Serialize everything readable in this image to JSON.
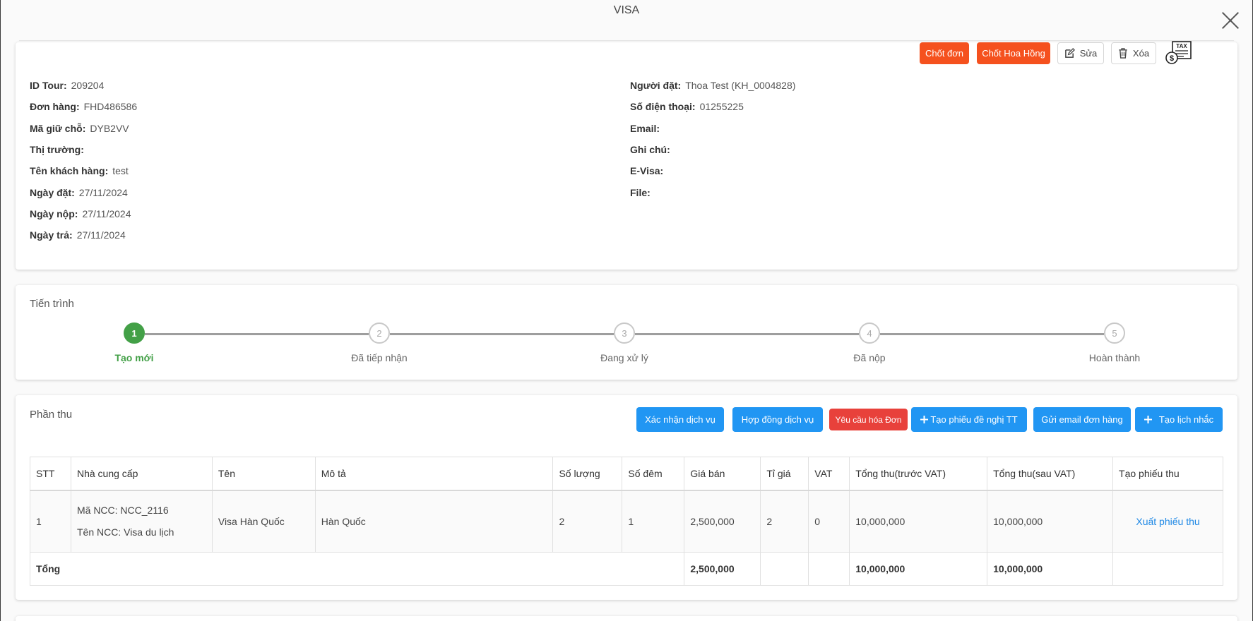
{
  "modal": {
    "title": "VISA"
  },
  "actions": {
    "chot_don": "Chốt đơn",
    "chot_hoa_hong": "Chốt Hoa Hồng",
    "sua": "Sửa",
    "xoa": "Xóa",
    "tax_icon": "tax-invoice-icon",
    "tax_text": "TAX"
  },
  "info": {
    "left": [
      {
        "label": "ID Tour",
        "value": "209204"
      },
      {
        "label": "Đơn hàng",
        "value": "FHD486586"
      },
      {
        "label": "Mã giữ chỗ",
        "value": "DYB2VV"
      },
      {
        "label": "Thị trường",
        "value": ""
      },
      {
        "label": "Tên khách hàng",
        "value": "test"
      },
      {
        "label": "Ngày đặt",
        "value": "27/11/2024"
      },
      {
        "label": "Ngày nộp",
        "value": "27/11/2024"
      },
      {
        "label": "Ngày trả",
        "value": "27/11/2024"
      }
    ],
    "right": [
      {
        "label": "Người đặt",
        "value": "Thoa Test (KH_0004828)"
      },
      {
        "label": "Số điện thoại",
        "value": "01255225"
      },
      {
        "label": "Email",
        "value": ""
      },
      {
        "label": "Ghi chú",
        "value": ""
      },
      {
        "label": "E-Visa",
        "value": ""
      },
      {
        "label": "File",
        "value": ""
      }
    ]
  },
  "progress": {
    "title": "Tiến trình",
    "current_step": 1,
    "steps": [
      {
        "num": "1",
        "label": "Tạo mới"
      },
      {
        "num": "2",
        "label": "Đã tiếp nhận"
      },
      {
        "num": "3",
        "label": "Đang xử lý"
      },
      {
        "num": "4",
        "label": "Đã nộp"
      },
      {
        "num": "5",
        "label": "Hoàn thành"
      }
    ],
    "colors": {
      "active": "#43a047",
      "inactive": "#c8c8c8"
    }
  },
  "phan_thu": {
    "title": "Phần thu",
    "buttons": {
      "xac_nhan": "Xác nhận dịch vụ",
      "hop_dong": "Hợp đồng dịch vụ",
      "yeu_cau_hoa_don": "Yêu cầu hóa Đơn",
      "tao_phieu_de_nghi": "Tạo phiếu đề nghị TT",
      "gui_email": "Gửi email đơn hàng",
      "tao_lich_nhac": "Tạo lịch nhắc"
    },
    "columns": [
      "STT",
      "Nhà cung cấp",
      "Tên",
      "Mô tả",
      "Số lượng",
      "Số đêm",
      "Giá bán",
      "Tỉ giá",
      "VAT",
      "Tổng thu(trước VAT)",
      "Tổng thu(sau VAT)",
      "Tạo phiếu thu"
    ],
    "row": {
      "stt": "1",
      "ma_ncc": "Mã NCC: NCC_2116",
      "ten_ncc": "Tên NCC: Visa du lịch",
      "ten": "Visa Hàn Quốc",
      "mo_ta": "Hàn Quốc",
      "so_luong": "2",
      "so_dem": "1",
      "gia_ban": "2,500,000",
      "ti_gia": "2",
      "vat": "0",
      "tong_truoc_vat": "10,000,000",
      "tong_sau_vat": "10,000,000",
      "xuat_phieu_thu": "Xuất phiếu thu"
    },
    "total": {
      "label": "Tổng",
      "gia_ban": "2,500,000",
      "tong_truoc_vat": "10,000,000",
      "tong_sau_vat": "10,000,000"
    }
  },
  "colors": {
    "orange": "#f5511e",
    "red": "#e8413b",
    "blue": "#2196f3",
    "green": "#43a047",
    "link": "#1e88e5"
  }
}
